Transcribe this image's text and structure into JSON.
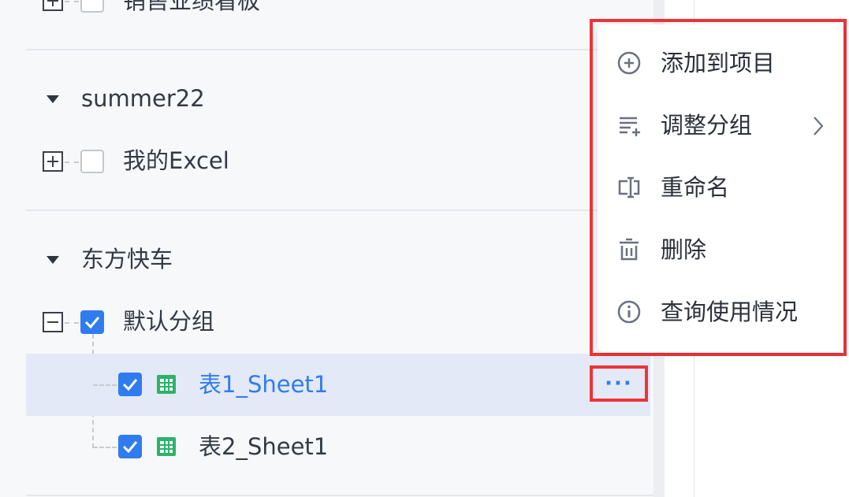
{
  "tree": {
    "group_top": {
      "item_label": "销售业绩看板"
    },
    "group_summer": {
      "label": "summer22",
      "item_label": "我的Excel"
    },
    "group_dongfang": {
      "label": "东方快车",
      "subgroup_label": "默认分组",
      "sheets": [
        {
          "label": "表1_Sheet1",
          "selected": true,
          "checked": true
        },
        {
          "label": "表2_Sheet1",
          "selected": false,
          "checked": true
        }
      ]
    },
    "more_button_label": "···"
  },
  "context_menu": {
    "items": [
      {
        "label": "添加到项目",
        "icon": "plus-circle-icon"
      },
      {
        "label": "调整分组",
        "icon": "regroup-icon",
        "has_submenu": true
      },
      {
        "label": "重命名",
        "icon": "rename-icon"
      },
      {
        "label": "删除",
        "icon": "trash-icon"
      },
      {
        "label": "查询使用情况",
        "icon": "info-icon"
      }
    ]
  },
  "colors": {
    "accent": "#2f7cf0",
    "selected_row_bg": "#e3e9f6",
    "highlight_red": "#ee3338",
    "sheet_icon_green": "#2bb36b"
  }
}
